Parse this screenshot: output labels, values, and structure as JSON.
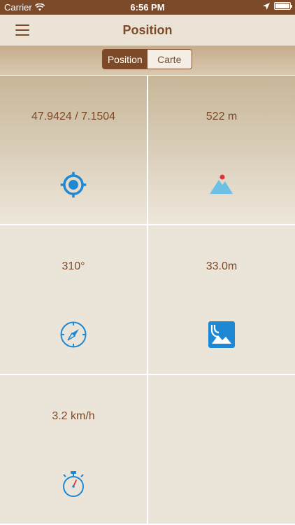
{
  "status_bar": {
    "carrier": "Carrier",
    "time": "6:56 PM"
  },
  "nav": {
    "title": "Position"
  },
  "segments": [
    {
      "label": "Position",
      "active": true
    },
    {
      "label": "Carte",
      "active": false
    }
  ],
  "cells": {
    "coordinates": "47.9424 / 7.1504",
    "altitude": "522 m",
    "heading": "310°",
    "accuracy": "33.0m",
    "speed": "3.2 km/h"
  },
  "colors": {
    "accent": "#7c4a28",
    "icon_blue": "#1e88d4",
    "background": "#ebe4d8"
  },
  "icons": [
    "location-target-icon",
    "mountain-icon",
    "compass-icon",
    "photo-accuracy-icon",
    "stopwatch-icon"
  ]
}
